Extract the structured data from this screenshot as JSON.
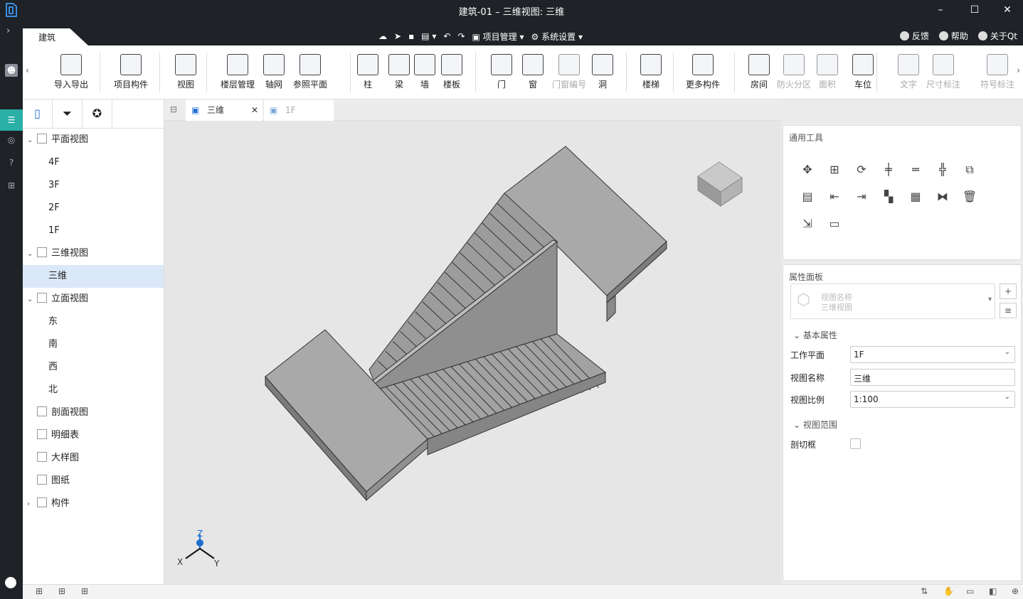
{
  "window": {
    "title": "建筑-01 – 三维视图: 三维"
  },
  "app_tab": "建筑",
  "menu": {
    "project": "项目管理",
    "settings": "系统设置"
  },
  "menu_right": {
    "feedback": "反馈",
    "help": "帮助",
    "about": "关于Qt"
  },
  "ribbon": [
    {
      "id": "import-export",
      "label": "导入导出",
      "icon": "cad-icon",
      "dim": false
    },
    {
      "id": "project-components",
      "label": "项目构件",
      "icon": "components-icon",
      "dim": false
    },
    {
      "id": "view",
      "label": "视图",
      "icon": "view-icon",
      "dim": false
    },
    {
      "id": "floor-mgmt",
      "label": "楼层管理",
      "icon": "floor-mgmt-icon",
      "dim": false
    },
    {
      "id": "axis",
      "label": "轴网",
      "icon": "axis-icon",
      "dim": false
    },
    {
      "id": "ref-plane",
      "label": "参照平面",
      "icon": "ref-plane-icon",
      "dim": false
    },
    {
      "id": "column",
      "label": "柱",
      "icon": "column-icon",
      "dim": false
    },
    {
      "id": "beam",
      "label": "梁",
      "icon": "beam-icon",
      "dim": false
    },
    {
      "id": "wall",
      "label": "墙",
      "icon": "wall-icon",
      "dim": false
    },
    {
      "id": "slab",
      "label": "楼板",
      "icon": "slab-icon",
      "dim": false
    },
    {
      "id": "door",
      "label": "门",
      "icon": "door-icon",
      "dim": false
    },
    {
      "id": "window",
      "label": "窗",
      "icon": "window-icon",
      "dim": false
    },
    {
      "id": "door-window-number",
      "label": "门窗编号",
      "icon": "tag-icon",
      "dim": true
    },
    {
      "id": "opening",
      "label": "洞",
      "icon": "opening-icon",
      "dim": false
    },
    {
      "id": "stair",
      "label": "楼梯",
      "icon": "stair-icon",
      "dim": false
    },
    {
      "id": "more-components",
      "label": "更多构件",
      "icon": "more-components-icon",
      "dim": false
    },
    {
      "id": "room",
      "label": "房间",
      "icon": "room-icon",
      "dim": false
    },
    {
      "id": "fire-zone",
      "label": "防火分区",
      "icon": "fire-zone-icon",
      "dim": true
    },
    {
      "id": "area",
      "label": "面积",
      "icon": "area-icon",
      "dim": true
    },
    {
      "id": "parking",
      "label": "车位",
      "icon": "parking-icon",
      "dim": false
    },
    {
      "id": "text",
      "label": "文字",
      "icon": "text-icon",
      "dim": true
    },
    {
      "id": "dimension",
      "label": "尺寸标注",
      "icon": "dimension-icon",
      "dim": true
    },
    {
      "id": "symbol",
      "label": "符号标注",
      "icon": "symbol-icon",
      "dim": true
    }
  ],
  "tree": [
    {
      "label": "平面视图",
      "level": 0,
      "expanded": true
    },
    {
      "label": "4F",
      "level": 1
    },
    {
      "label": "3F",
      "level": 1
    },
    {
      "label": "2F",
      "level": 1
    },
    {
      "label": "1F",
      "level": 1
    },
    {
      "label": "三维视图",
      "level": 0,
      "expanded": true
    },
    {
      "label": "三维",
      "level": 1,
      "selected": true
    },
    {
      "label": "立面视图",
      "level": 0,
      "expanded": true
    },
    {
      "label": "东",
      "level": 1
    },
    {
      "label": "南",
      "level": 1
    },
    {
      "label": "西",
      "level": 1
    },
    {
      "label": "北",
      "level": 1
    },
    {
      "label": "剖面视图",
      "level": 0
    },
    {
      "label": "明细表",
      "level": 0
    },
    {
      "label": "大样图",
      "level": 0
    },
    {
      "label": "图纸",
      "level": 0
    },
    {
      "label": "构件",
      "level": 0,
      "collapsed": true
    }
  ],
  "view_tabs": [
    {
      "label": "三维",
      "active": true
    },
    {
      "label": "1F",
      "active": false
    }
  ],
  "axes": {
    "x": "X",
    "y": "Y",
    "z": "Z"
  },
  "right_panel": {
    "tools_title": "通用工具",
    "props_title": "属性面板",
    "type_name": "视图名称",
    "type_value": "三维视图",
    "section_basic": "基本属性",
    "section_range": "视图范围",
    "fields": {
      "work_plane": {
        "label": "工作平面",
        "value": "1F"
      },
      "view_name": {
        "label": "视图名称",
        "value": "三维"
      },
      "view_scale": {
        "label": "视图比例",
        "value": "1:100"
      },
      "section_box": {
        "label": "剖切框"
      }
    }
  }
}
